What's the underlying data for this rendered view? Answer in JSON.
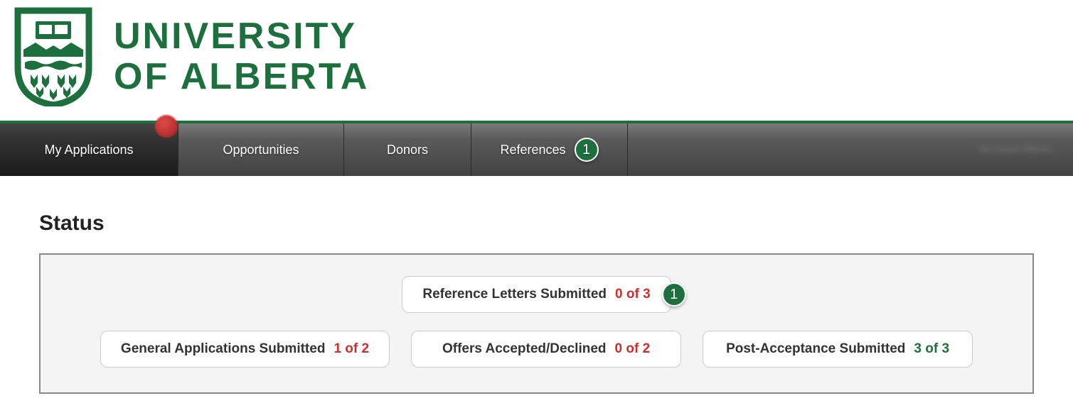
{
  "brand": {
    "line1": "UNIVERSITY",
    "line2": "OF ALBERTA",
    "color": "#1e6f3e"
  },
  "nav": {
    "items": [
      {
        "label": "My Applications",
        "active": true
      },
      {
        "label": "Opportunities",
        "active": false
      },
      {
        "label": "Donors",
        "active": false
      },
      {
        "label": "References",
        "active": false,
        "badge": "1"
      }
    ],
    "right_text": "Account Menu"
  },
  "status": {
    "heading": "Status",
    "top": {
      "label": "Reference Letters Submitted",
      "value": "0 of 3",
      "value_color": "red",
      "badge": "1"
    },
    "items": [
      {
        "label": "General Applications Submitted",
        "value": "1 of 2",
        "value_color": "red"
      },
      {
        "label": "Offers Accepted/Declined",
        "value": "0 of 2",
        "value_color": "red"
      },
      {
        "label": "Post-Acceptance Submitted",
        "value": "3 of 3",
        "value_color": "green"
      }
    ]
  }
}
